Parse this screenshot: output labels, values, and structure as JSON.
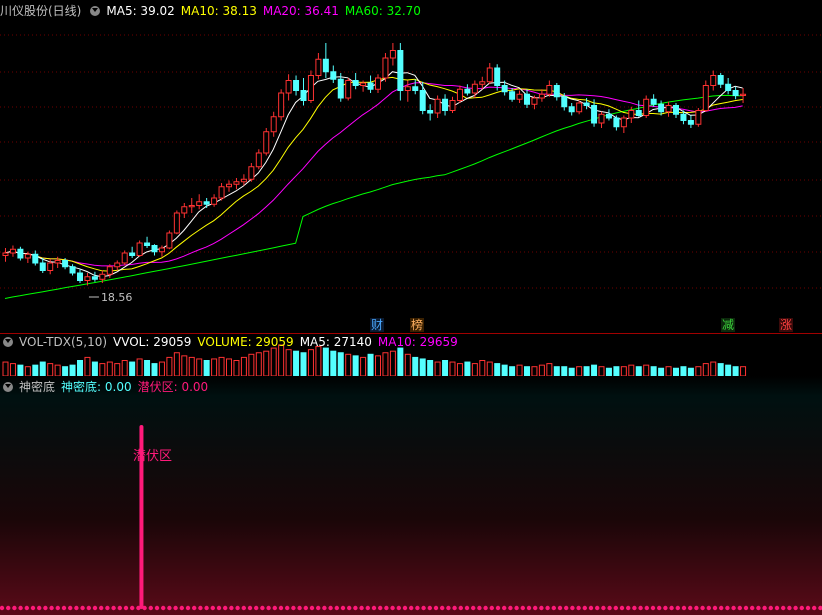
{
  "header": {
    "stock_title": "川仪股份(日线)",
    "ma5": "MA5: 39.02",
    "ma10": "MA10: 38.13",
    "ma20": "MA20: 36.41",
    "ma60": "MA60: 32.70"
  },
  "events": [
    {
      "label": "财",
      "color": "#4aa8ff"
    },
    {
      "label": "榜",
      "color": "#ffb060"
    },
    {
      "label": "减",
      "color": "#3cd23c"
    },
    {
      "label": "涨",
      "color": "#ff4040"
    }
  ],
  "volume_header": {
    "name": "VOL-TDX(5,10)",
    "vvol": "VVOL: 29059",
    "volume": "VOLUME: 29059",
    "ma5": "MA5: 27140",
    "ma10": "MA10: 29659"
  },
  "indicator_header": {
    "name": "神密底",
    "v1": "神密底: 0.00",
    "v2": "潜伏区: 0.00"
  },
  "indicator_label": "潜伏区",
  "min_price_label": "18.56",
  "colors": {
    "up": "#ff3232",
    "down": "#54ffff",
    "ma5": "#ffffff",
    "ma10": "#ffff00",
    "ma20": "#ff00ff",
    "ma60": "#00ff00",
    "grid": "#6e0000",
    "signal": "#ff1a7a"
  },
  "chart_data": {
    "type": "candlestick",
    "candles": [
      [
        21.0,
        21.6,
        20.5,
        21.2
      ],
      [
        21.2,
        21.8,
        20.9,
        21.5
      ],
      [
        21.5,
        21.7,
        20.6,
        20.8
      ],
      [
        20.8,
        21.3,
        20.4,
        21.1
      ],
      [
        21.1,
        21.4,
        20.2,
        20.4
      ],
      [
        20.4,
        20.8,
        19.6,
        19.8
      ],
      [
        19.8,
        20.7,
        19.5,
        20.4
      ],
      [
        20.4,
        20.9,
        20.0,
        20.6
      ],
      [
        20.6,
        20.8,
        19.9,
        20.1
      ],
      [
        20.1,
        20.3,
        19.4,
        19.6
      ],
      [
        19.6,
        19.9,
        18.8,
        19.0
      ],
      [
        19.0,
        19.6,
        18.6,
        19.3
      ],
      [
        19.3,
        19.7,
        18.9,
        19.1
      ],
      [
        19.1,
        19.8,
        18.8,
        19.5
      ],
      [
        19.5,
        20.3,
        19.2,
        20.1
      ],
      [
        20.1,
        20.6,
        19.8,
        20.4
      ],
      [
        20.4,
        21.4,
        20.2,
        21.2
      ],
      [
        21.2,
        21.7,
        20.8,
        21.0
      ],
      [
        21.0,
        22.2,
        20.9,
        22.0
      ],
      [
        22.0,
        22.5,
        21.6,
        21.8
      ],
      [
        21.8,
        21.9,
        21.0,
        21.3
      ],
      [
        21.3,
        21.8,
        20.9,
        21.6
      ],
      [
        21.6,
        23.0,
        21.5,
        22.8
      ],
      [
        22.8,
        24.6,
        22.7,
        24.4
      ],
      [
        24.4,
        25.2,
        24.0,
        24.9
      ],
      [
        24.9,
        25.6,
        24.4,
        25.0
      ],
      [
        25.0,
        25.9,
        24.7,
        25.3
      ],
      [
        25.3,
        25.6,
        24.8,
        25.1
      ],
      [
        25.1,
        25.9,
        24.9,
        25.6
      ],
      [
        25.6,
        26.8,
        25.4,
        26.5
      ],
      [
        26.5,
        27.0,
        26.1,
        26.7
      ],
      [
        26.7,
        27.2,
        26.3,
        26.9
      ],
      [
        26.9,
        27.5,
        26.6,
        27.1
      ],
      [
        27.1,
        28.4,
        26.9,
        28.1
      ],
      [
        28.1,
        29.5,
        27.9,
        29.2
      ],
      [
        29.2,
        31.2,
        29.0,
        30.9
      ],
      [
        30.9,
        32.5,
        30.5,
        32.1
      ],
      [
        32.1,
        34.3,
        31.8,
        34.0
      ],
      [
        34.0,
        35.5,
        33.4,
        35.0
      ],
      [
        35.0,
        35.4,
        33.8,
        34.2
      ],
      [
        34.2,
        35.2,
        33.0,
        33.4
      ],
      [
        33.4,
        35.8,
        33.2,
        35.4
      ],
      [
        35.4,
        37.2,
        35.1,
        36.7
      ],
      [
        36.7,
        38.0,
        35.2,
        35.7
      ],
      [
        35.7,
        36.2,
        34.8,
        35.1
      ],
      [
        35.1,
        35.6,
        33.3,
        33.6
      ],
      [
        33.6,
        35.2,
        33.4,
        35.0
      ],
      [
        35.0,
        35.6,
        34.3,
        34.6
      ],
      [
        34.6,
        35.0,
        34.1,
        34.8
      ],
      [
        34.8,
        35.4,
        34.0,
        34.3
      ],
      [
        34.3,
        35.5,
        34.0,
        35.2
      ],
      [
        35.2,
        37.2,
        34.9,
        36.8
      ],
      [
        36.8,
        38.0,
        36.2,
        37.4
      ],
      [
        37.4,
        38.0,
        33.4,
        34.2
      ],
      [
        34.2,
        35.0,
        33.3,
        34.5
      ],
      [
        34.5,
        35.1,
        33.9,
        34.2
      ],
      [
        34.2,
        34.9,
        32.3,
        32.6
      ],
      [
        32.6,
        33.1,
        31.8,
        32.4
      ],
      [
        32.4,
        33.8,
        32.0,
        33.5
      ],
      [
        33.5,
        33.9,
        32.2,
        32.6
      ],
      [
        32.6,
        33.7,
        32.4,
        33.4
      ],
      [
        33.4,
        34.6,
        33.2,
        34.3
      ],
      [
        34.3,
        34.7,
        33.8,
        34.0
      ],
      [
        34.0,
        35.0,
        33.6,
        34.7
      ],
      [
        34.7,
        35.3,
        34.3,
        34.9
      ],
      [
        34.9,
        36.4,
        34.7,
        36.0
      ],
      [
        36.0,
        36.3,
        34.2,
        34.6
      ],
      [
        34.6,
        35.0,
        33.8,
        34.1
      ],
      [
        34.1,
        34.4,
        33.3,
        33.5
      ],
      [
        33.5,
        34.2,
        33.2,
        33.9
      ],
      [
        33.9,
        34.3,
        32.8,
        33.1
      ],
      [
        33.1,
        33.8,
        32.7,
        33.6
      ],
      [
        33.6,
        34.3,
        33.3,
        33.9
      ],
      [
        33.9,
        35.0,
        33.7,
        34.6
      ],
      [
        34.6,
        34.8,
        33.4,
        33.7
      ],
      [
        33.7,
        34.0,
        32.6,
        32.9
      ],
      [
        32.9,
        33.2,
        32.2,
        32.5
      ],
      [
        32.5,
        33.4,
        32.3,
        33.2
      ],
      [
        33.2,
        33.6,
        32.7,
        33.0
      ],
      [
        33.0,
        33.5,
        31.3,
        31.6
      ],
      [
        31.6,
        32.5,
        31.2,
        32.3
      ],
      [
        32.3,
        32.7,
        31.8,
        32.0
      ],
      [
        32.0,
        32.2,
        31.0,
        31.3
      ],
      [
        31.3,
        32.2,
        30.8,
        32.0
      ],
      [
        32.0,
        32.9,
        31.6,
        32.6
      ],
      [
        32.6,
        33.4,
        32.1,
        32.2
      ],
      [
        32.2,
        33.8,
        32.0,
        33.5
      ],
      [
        33.5,
        33.9,
        32.9,
        33.1
      ],
      [
        33.1,
        33.4,
        32.2,
        32.5
      ],
      [
        32.5,
        33.3,
        32.1,
        33.0
      ],
      [
        33.0,
        33.2,
        32.0,
        32.3
      ],
      [
        32.3,
        32.6,
        31.5,
        31.8
      ],
      [
        31.8,
        32.2,
        31.2,
        31.5
      ],
      [
        31.5,
        32.8,
        31.3,
        32.6
      ],
      [
        32.6,
        35.0,
        32.5,
        34.6
      ],
      [
        34.6,
        35.8,
        34.2,
        35.4
      ],
      [
        35.4,
        35.6,
        34.4,
        34.7
      ],
      [
        34.7,
        35.2,
        33.9,
        34.2
      ],
      [
        34.2,
        34.5,
        33.5,
        33.8
      ],
      [
        33.8,
        34.4,
        33.2,
        33.9
      ]
    ],
    "volume": [
      9,
      8,
      7,
      6,
      7,
      9,
      8,
      7,
      6,
      7,
      10,
      12,
      9,
      8,
      9,
      8,
      10,
      9,
      11,
      10,
      8,
      9,
      12,
      15,
      13,
      12,
      11,
      10,
      11,
      12,
      11,
      10,
      12,
      14,
      15,
      16,
      18,
      20,
      17,
      16,
      15,
      17,
      19,
      18,
      16,
      15,
      14,
      13,
      12,
      14,
      13,
      15,
      16,
      18,
      14,
      12,
      11,
      10,
      9,
      10,
      9,
      8,
      9,
      8,
      10,
      9,
      8,
      7,
      6,
      7,
      6,
      6,
      7,
      8,
      6,
      6,
      5,
      6,
      6,
      7,
      6,
      5,
      6,
      6,
      7,
      6,
      7,
      6,
      5,
      6,
      5,
      6,
      5,
      6,
      8,
      9,
      8,
      7,
      6,
      6
    ],
    "signal_index": 21,
    "price_range": [
      16,
      40
    ],
    "min_price": 18.56,
    "event_indices": [
      58,
      66,
      114,
      122
    ]
  }
}
